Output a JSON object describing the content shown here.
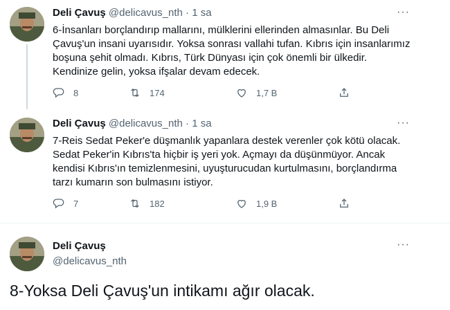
{
  "tweets": [
    {
      "name": "Deli Çavuş",
      "handle": "@delicavus_nth",
      "dot": "·",
      "time": "1 sa",
      "more": "···",
      "text": "6-İnsanları borçlandırıp mallarını, mülklerini ellerinden almasınlar. Bu Deli Çavuş'un insani uyarısıdır. Yoksa sonrası vallahi tufan. Kıbrıs için insanlarımız boşuna şehit olmadı. Kıbrıs, Türk Dünyası için çok önemli bir ülkedir. Kendinize gelin, yoksa ifşalar devam edecek.",
      "replies": "8",
      "retweets": "174",
      "likes": "1,7 B"
    },
    {
      "name": "Deli Çavuş",
      "handle": "@delicavus_nth",
      "dot": "·",
      "time": "1 sa",
      "more": "···",
      "text": "7-Reis Sedat Peker'e düşmanlık yapanlara destek verenler çok kötü olacak. Sedat Peker'in Kıbrıs'ta hiçbir iş yeri yok. Açmayı da düşünmüyor. Ancak kendisi Kıbrıs'ın temizlenmesini, uyuşturucudan kurtulmasını, borçlandırma tarzı kumarın son bulmasını istiyor.",
      "replies": "7",
      "retweets": "182",
      "likes": "1,9 B"
    }
  ],
  "focused": {
    "name": "Deli Çavuş",
    "handle": "@delicavus_nth",
    "more": "···",
    "text": "8-Yoksa Deli Çavuş'un intikamı ağır olacak."
  },
  "colors": {
    "text": "#0f1419",
    "muted": "#536471",
    "line": "#cfd9de"
  },
  "icons": [
    "reply-icon",
    "retweet-icon",
    "like-icon",
    "share-icon",
    "more-icon"
  ]
}
